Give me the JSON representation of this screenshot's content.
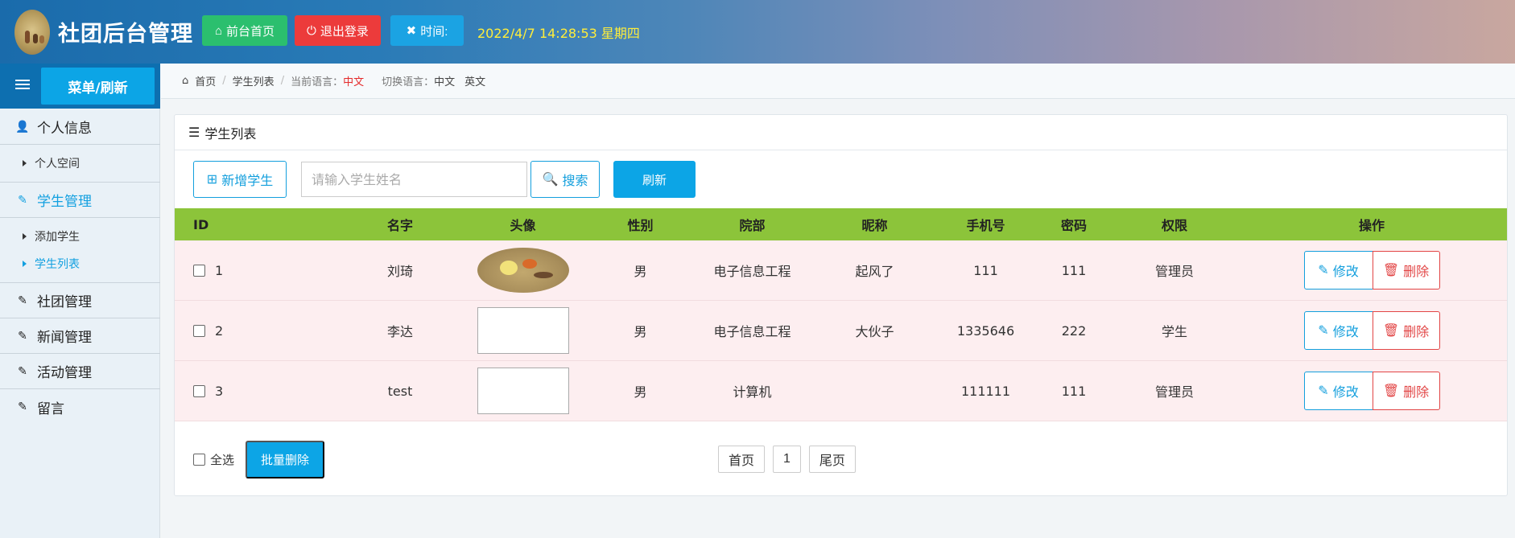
{
  "header": {
    "site_title": "社团后台管理",
    "home_button": "前台首页",
    "logout_button": "退出登录",
    "time_button": "时间:",
    "clock": "2022/4/7 14:28:53 星期四"
  },
  "sidebar": {
    "menu_refresh": "菜单/刷新",
    "groups": [
      {
        "label": "个人信息",
        "subs": [
          "个人空间"
        ]
      },
      {
        "label": "学生管理",
        "subs": [
          "添加学生",
          "学生列表"
        ]
      },
      {
        "label": "社团管理"
      },
      {
        "label": "新闻管理"
      },
      {
        "label": "活动管理"
      },
      {
        "label": "留言"
      }
    ]
  },
  "breadcrumb": {
    "home": "首页",
    "current": "学生列表",
    "lang_label": "当前语言：",
    "lang_value": "中文",
    "switch_label": "切换语言：",
    "lang_cn": "中文",
    "lang_en": "英文"
  },
  "panel": {
    "title": "学生列表",
    "add_button": "新增学生",
    "search_placeholder": "请输入学生姓名",
    "search_button": "搜索",
    "refresh_button": "刷新"
  },
  "table": {
    "headers": [
      "ID",
      "名字",
      "头像",
      "性别",
      "院部",
      "昵称",
      "手机号",
      "密码",
      "权限",
      "操作"
    ],
    "rows": [
      {
        "id": "1",
        "name": "刘琦",
        "sex": "男",
        "dept": "电子信息工程",
        "nick": "起风了",
        "phone": "111",
        "pwd": "111",
        "role": "管理员"
      },
      {
        "id": "2",
        "name": "李达",
        "sex": "男",
        "dept": "电子信息工程",
        "nick": "大伙子",
        "phone": "1335646",
        "pwd": "222",
        "role": "学生"
      },
      {
        "id": "3",
        "name": "test",
        "sex": "男",
        "dept": "计算机",
        "nick": "",
        "phone": "111111",
        "pwd": "111",
        "role": "管理员"
      }
    ],
    "edit_label": "修改",
    "delete_label": "删除"
  },
  "footer": {
    "check_all": "全选",
    "batch_delete": "批量删除",
    "first_page": "首页",
    "page_num": "1",
    "last_page": "尾页"
  }
}
